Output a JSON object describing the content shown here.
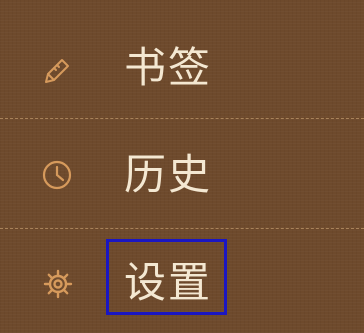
{
  "menu": {
    "items": [
      {
        "label": "书签",
        "icon": "pencil-icon"
      },
      {
        "label": "历史",
        "icon": "clock-icon"
      },
      {
        "label": "设置",
        "icon": "gear-icon"
      }
    ]
  },
  "colors": {
    "background": "#6e4a2c",
    "icon": "#d69a5c",
    "label": "#f4e8d2",
    "selection_border": "#1a16c2"
  }
}
